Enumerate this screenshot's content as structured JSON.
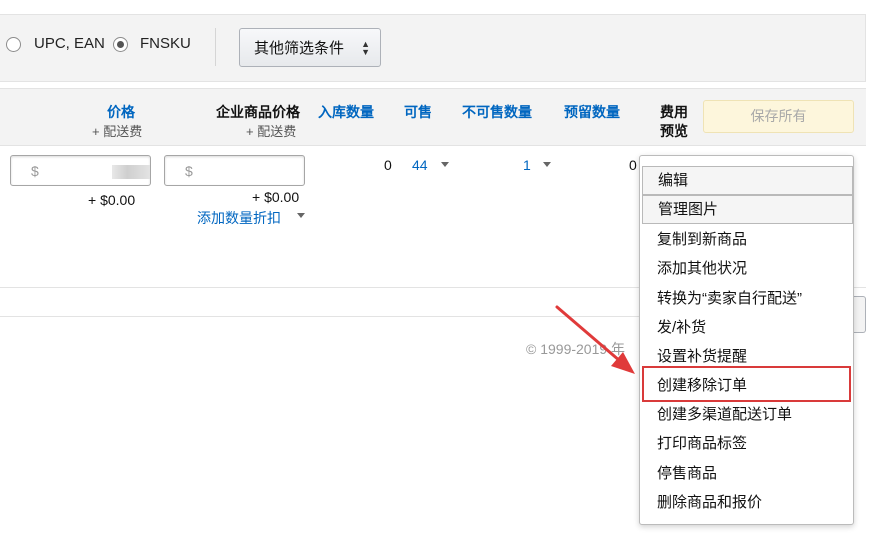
{
  "filters": {
    "radio_options": [
      {
        "label": "UPC, EAN",
        "checked": false
      },
      {
        "label": "FNSKU",
        "checked": true
      }
    ],
    "other_filters_label": "其他筛选条件"
  },
  "columns": {
    "price": {
      "label": "价格",
      "sub": "+ 配送费"
    },
    "business_price": {
      "label": "企业商品价格",
      "sub": "+ 配送费"
    },
    "inbound": {
      "label": "入库数量"
    },
    "available": {
      "label": "可售"
    },
    "unsellable": {
      "label": "不可售数量"
    },
    "reserved": {
      "label": "预留数量"
    },
    "fee_preview": {
      "label_line1": "费用",
      "label_line2": "预览"
    },
    "save_all_label": "保存所有"
  },
  "row": {
    "price_currency": "$",
    "price_shipping": "+ $0.00",
    "business_currency": "$",
    "business_shipping": "+ $0.00",
    "add_quantity_discount": "添加数量折扣",
    "inbound": "0",
    "available": "44",
    "unsellable": "1",
    "reserved": "0"
  },
  "actions_menu": {
    "items": [
      {
        "label": "编辑",
        "boxed": true
      },
      {
        "label": "管理图片",
        "boxed": true
      },
      {
        "label": "复制到新商品"
      },
      {
        "label": "添加其他状况"
      },
      {
        "label": "转换为“卖家自行配送”"
      },
      {
        "label": "发/补货"
      },
      {
        "label": "设置补货提醒"
      },
      {
        "label": "创建移除订单",
        "highlighted": true
      },
      {
        "label": "创建多渠道配送订单"
      },
      {
        "label": "打印商品标签"
      },
      {
        "label": "停售商品"
      },
      {
        "label": "删除商品和报价"
      }
    ]
  },
  "footer": {
    "copyright": "© 1999-2019 年"
  },
  "colors": {
    "link": "#0066c0",
    "highlight": "#d93a3a",
    "save_bg": "#fdf6dc"
  }
}
